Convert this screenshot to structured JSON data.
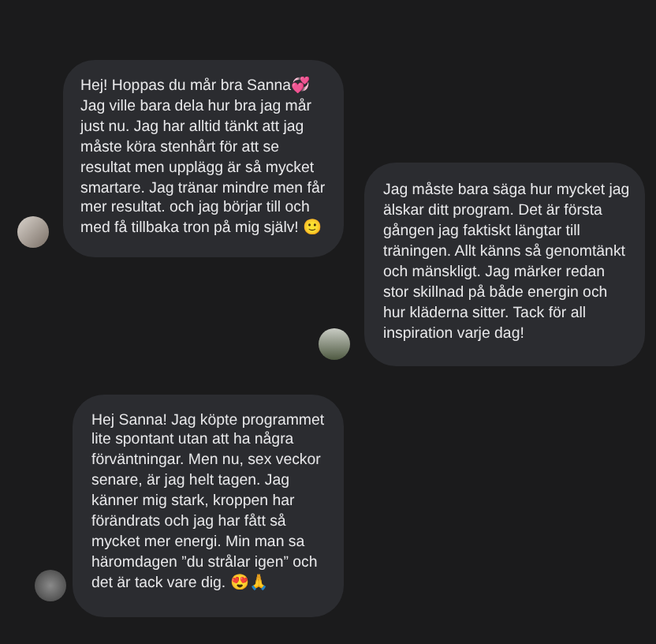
{
  "messages": [
    {
      "text": "Hej! Hoppas du mår bra Sanna💞 Jag ville bara dela hur bra jag mår just nu. Jag har alltid tänkt att jag måste köra stenhårt för att se resultat men upplägg är så mycket smartare. Jag tränar mindre men får mer resultat. och jag börjar till och med få tillbaka tron på mig själv! 🙂"
    },
    {
      "text": "Jag måste bara säga hur mycket jag älskar ditt program. Det är första gången jag faktiskt längtar till träningen. Allt känns så genomtänkt och mänskligt. Jag märker redan stor skillnad på både energin och hur kläderna sitter. Tack för all inspiration varje dag!"
    },
    {
      "text": "Hej Sanna! Jag köpte programmet lite spontant utan att ha några förväntningar. Men nu, sex veckor senare, är jag helt tagen. Jag känner mig stark, kroppen har förändrats och jag har fått så mycket mer energi. Min man sa häromdagen ”du strålar igen” och det är tack vare dig. 😍🙏"
    }
  ]
}
